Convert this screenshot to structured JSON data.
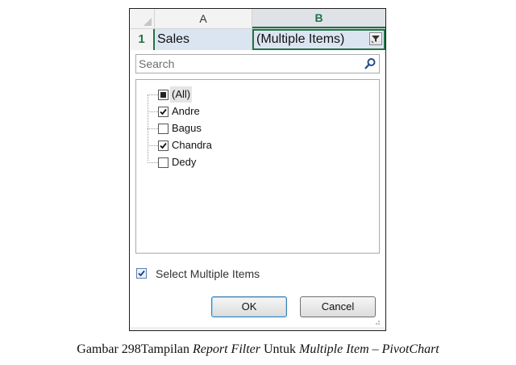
{
  "sheet": {
    "corner": "",
    "columns": [
      "A",
      "B"
    ],
    "row_number": "1",
    "cell_a1": "Sales",
    "cell_b1": "(Multiple Items)"
  },
  "filter": {
    "search_placeholder": "Search",
    "items": [
      {
        "label": "(All)",
        "state": "partial"
      },
      {
        "label": "Andre",
        "state": "checked"
      },
      {
        "label": "Bagus",
        "state": "unchecked"
      },
      {
        "label": "Chandra",
        "state": "checked"
      },
      {
        "label": "Dedy",
        "state": "unchecked"
      }
    ],
    "select_multiple_label": "Select Multiple Items",
    "select_multiple_checked": true,
    "ok_label": "OK",
    "cancel_label": "Cancel"
  },
  "caption": {
    "prefix": "Gambar 298Tampilan ",
    "italic1": "Report Filter",
    "middle": " Untuk ",
    "italic2": "Multiple Item – PivotChart"
  },
  "colors": {
    "accent_green": "#217346",
    "selection_blue": "#dbe5f1"
  },
  "icons": {
    "filter": "filter-funnel-icon",
    "search": "magnifier-icon",
    "check": "checkmark-icon"
  }
}
